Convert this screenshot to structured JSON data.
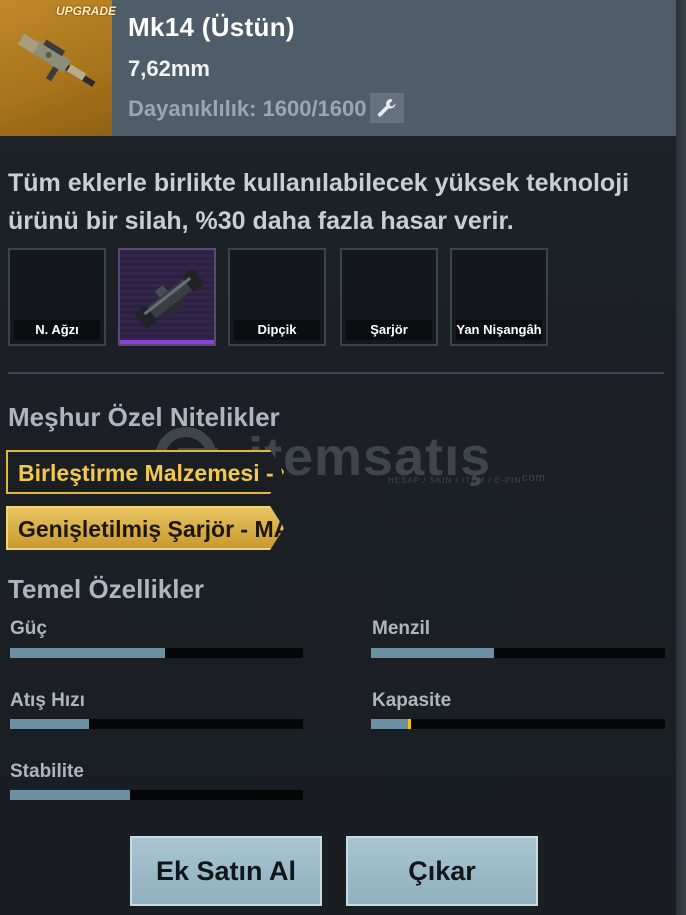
{
  "item": {
    "badge": "UPGRADE",
    "title": "Mk14 (Üstün)",
    "caliber": "7,62mm",
    "durability": "Dayanıklılık: 1600/1600",
    "wrench_icon": "wrench-icon"
  },
  "description": "Tüm eklerle birlikte kullanılabilecek yüksek teknoloji ürünü bir silah, %30 daha fazla hasar verir.",
  "slots": [
    {
      "label": "N. Ağzı",
      "equipped": false
    },
    {
      "label": "",
      "equipped": true,
      "icon": "scope-attachment-icon"
    },
    {
      "label": "Dipçik",
      "equipped": false
    },
    {
      "label": "Şarjör",
      "equipped": false
    },
    {
      "label": "Yan Nişangâh",
      "equipped": false
    }
  ],
  "special": {
    "title": "Meşhur Özel Nitelikler",
    "tags": [
      {
        "label": "Birleştirme Malzemesi - S",
        "style": "outline"
      },
      {
        "label": "Genişletilmiş Şarjör - MAX",
        "style": "filled"
      }
    ]
  },
  "stats": {
    "title": "Temel Özellikler",
    "items": [
      {
        "label": "Güç",
        "value": 0.53
      },
      {
        "label": "Menzil",
        "value": 0.42
      },
      {
        "label": "Atış Hızı",
        "value": 0.27
      },
      {
        "label": "Kapasite",
        "value": 0.13,
        "marker": true
      },
      {
        "label": "Stabilite",
        "value": 0.41
      }
    ]
  },
  "buttons": {
    "buy": "Ek Satın Al",
    "remove": "Çıkar"
  },
  "watermark": {
    "text": "itemsatış",
    "sub": "HESAP / SKIN / ITEM / E-PIN",
    "suffix": ".com"
  },
  "colors": {
    "header": "#4e5d69",
    "accent_gold": "#e3b73b",
    "bar_fill": "#6b8fa3",
    "equipped_purple": "#8a3fd6"
  }
}
